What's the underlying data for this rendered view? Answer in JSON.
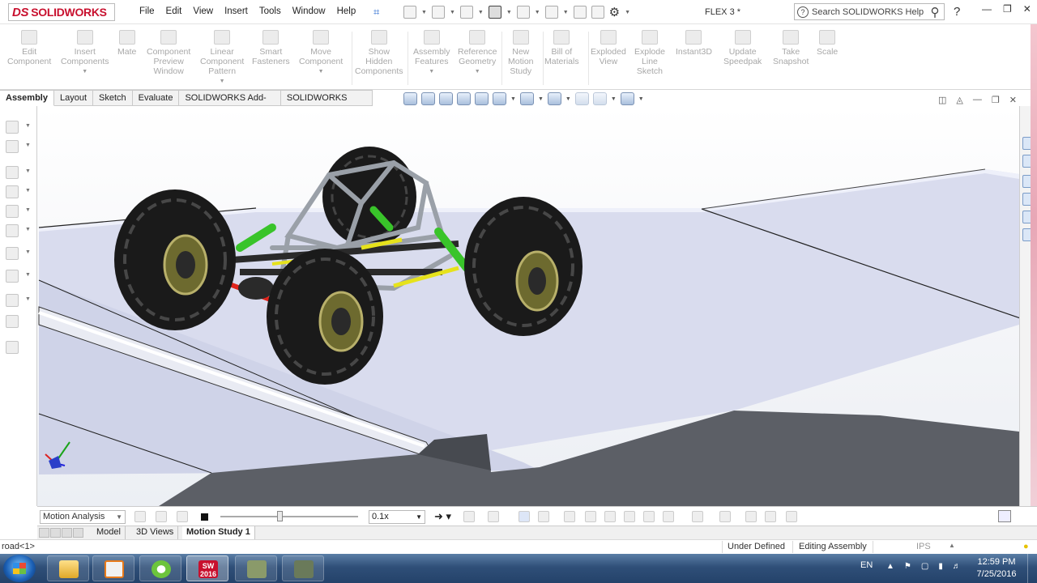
{
  "app": {
    "logo_text": "SOLIDWORKS",
    "logo_prefix": "DS",
    "document_title": "FLEX 3 *"
  },
  "menu": [
    "File",
    "Edit",
    "View",
    "Insert",
    "Tools",
    "Window",
    "Help"
  ],
  "search": {
    "placeholder": "Search SOLIDWORKS Help"
  },
  "help_label": "?",
  "commands": [
    {
      "lines": [
        "Edit",
        "Component"
      ],
      "icon": "edit-component-icon"
    },
    {
      "lines": [
        "Insert",
        "Components"
      ],
      "icon": "insert-components-icon",
      "dropdown": true
    },
    {
      "lines": [
        "Mate"
      ],
      "icon": "mate-icon"
    },
    {
      "lines": [
        "Component",
        "Preview",
        "Window"
      ],
      "icon": "component-preview-icon"
    },
    {
      "lines": [
        "Linear",
        "Component",
        "Pattern"
      ],
      "icon": "linear-pattern-icon",
      "dropdown": true
    },
    {
      "lines": [
        "Smart",
        "Fasteners"
      ],
      "icon": "smart-fasteners-icon"
    },
    {
      "lines": [
        "Move",
        "Component"
      ],
      "icon": "move-component-icon",
      "dropdown": true
    },
    {
      "lines": [
        "Show",
        "Hidden",
        "Components"
      ],
      "icon": "show-hidden-icon"
    },
    {
      "lines": [
        "Assembly",
        "Features"
      ],
      "icon": "assembly-features-icon",
      "dropdown": true
    },
    {
      "lines": [
        "Reference",
        "Geometry"
      ],
      "icon": "reference-geometry-icon",
      "dropdown": true
    },
    {
      "lines": [
        "New",
        "Motion",
        "Study"
      ],
      "icon": "new-motion-study-icon"
    },
    {
      "lines": [
        "Bill of",
        "Materials"
      ],
      "icon": "bill-of-materials-icon"
    },
    {
      "lines": [
        "Exploded",
        "View"
      ],
      "icon": "exploded-view-icon"
    },
    {
      "lines": [
        "Explode",
        "Line",
        "Sketch"
      ],
      "icon": "explode-line-sketch-icon"
    },
    {
      "lines": [
        "Instant3D"
      ],
      "icon": "instant3d-icon"
    },
    {
      "lines": [
        "Update",
        "Speedpak"
      ],
      "icon": "update-speedpak-icon"
    },
    {
      "lines": [
        "Take",
        "Snapshot"
      ],
      "icon": "take-snapshot-icon"
    },
    {
      "lines": [
        "Scale"
      ],
      "icon": "scale-icon"
    }
  ],
  "tabs": [
    "Assembly",
    "Layout",
    "Sketch",
    "Evaluate",
    "SOLIDWORKS Add-Ins",
    "SOLIDWORKS MBD"
  ],
  "active_tab": "Assembly",
  "motion": {
    "study_type": "Motion Analysis",
    "playback_speed": "0.1x"
  },
  "bottom_tabs": [
    "Model",
    "3D Views",
    "Motion Study 1"
  ],
  "active_bottom_tab": "Motion Study 1",
  "status": {
    "left": "road<1>",
    "definition": "Under Defined",
    "mode": "Editing Assembly",
    "units": "IPS"
  },
  "taskbar": {
    "language": "EN",
    "time": "12:59 PM",
    "date": "7/25/2016",
    "sw_badge": "2016"
  },
  "colors": {
    "brand_red": "#c8102e",
    "tire": "#1a1a1a",
    "rollcage": "#9aa0a8",
    "shock_green": "#39c42a",
    "link_yellow": "#e6e21c",
    "axle_red": "#e0241c",
    "terrain": "#d9dcee",
    "ground_dark": "#5c5f66"
  }
}
